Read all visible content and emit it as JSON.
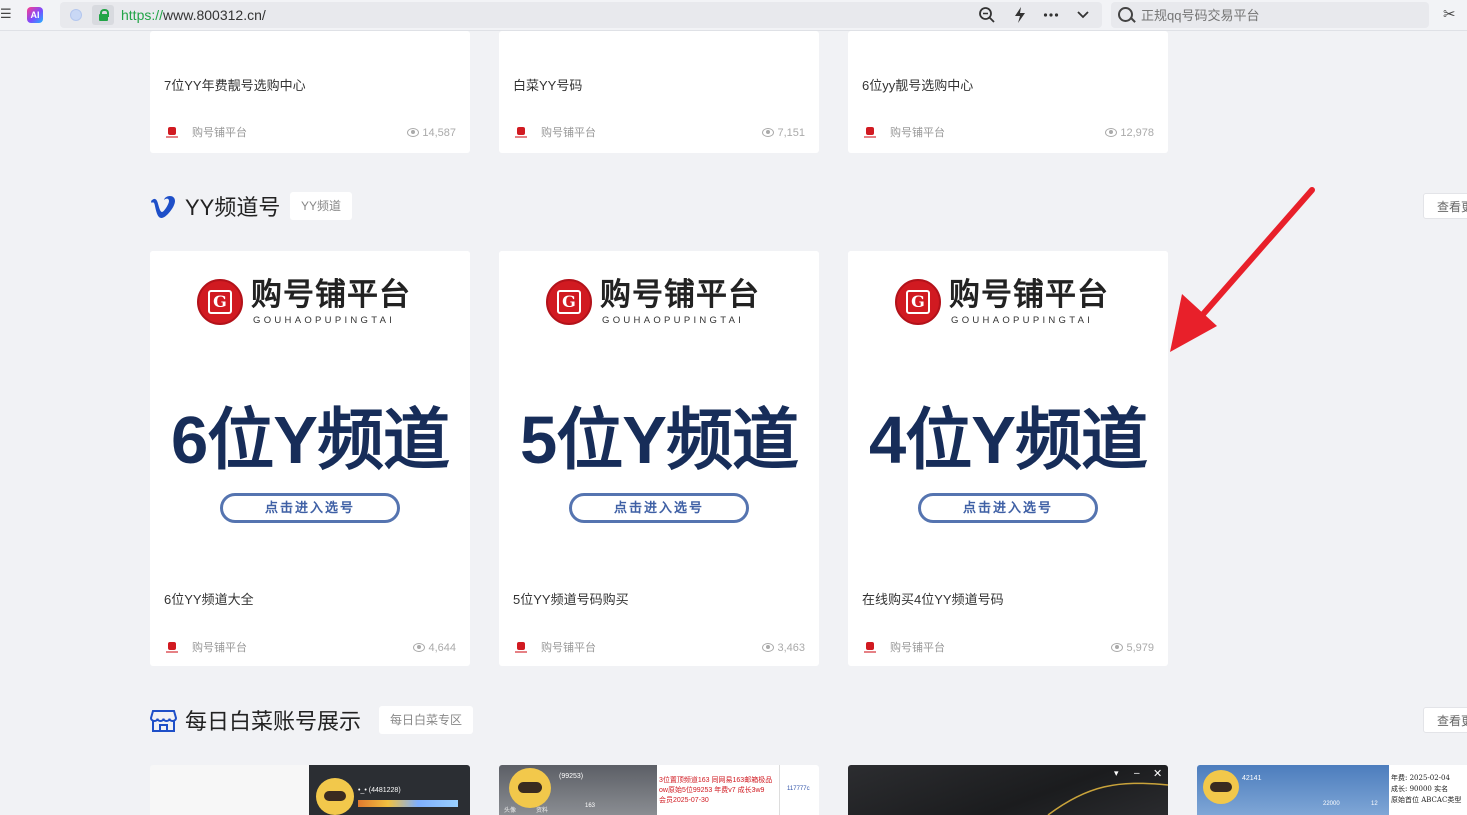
{
  "browser": {
    "left_icon": "books-icon",
    "ai_badge": "AI",
    "url_scheme": "https://",
    "url_rest": "www.800312.cn/",
    "search_placeholder": "正规qq号码交易平台",
    "scissors": "✂"
  },
  "top_cards": [
    {
      "title": "7位YY年费靓号选购中心",
      "author": "购号铺平台",
      "views": "14,587"
    },
    {
      "title": "白菜YY号码",
      "author": "购号铺平台",
      "views": "7,151"
    },
    {
      "title": "6位yy靓号选购中心",
      "author": "购号铺平台",
      "views": "12,978"
    }
  ],
  "section_yy": {
    "title": "YY频道号",
    "tag": "YY频道",
    "more": "查看更多"
  },
  "brand": {
    "emblem_letter": "G",
    "name": "购号铺平台",
    "sub": "GOUHAOPUPINGTAI",
    "button": "点击进入选号"
  },
  "yy_cards": [
    {
      "poster_text": "6位Y频道",
      "title": "6位YY频道大全",
      "author": "购号铺平台",
      "views": "4,644"
    },
    {
      "poster_text": "5位Y频道",
      "title": "5位YY频道号码购买",
      "author": "购号铺平台",
      "views": "3,463"
    },
    {
      "poster_text": "4位Y频道",
      "title": "在线购买4位YY频道号码",
      "author": "购号铺平台",
      "views": "5,979"
    }
  ],
  "section_daily": {
    "title": "每日白菜账号展示",
    "tag": "每日白菜专区",
    "more": "查看更多"
  },
  "daily_thumbs": [
    {
      "caption": "•_• (4481228)"
    },
    {
      "caption": "(99253)",
      "detail_1": "3位置顶频道163  同网易163邮箱极品",
      "detail_2": "ow原始5位99253 年费v7 成长3w9",
      "detail_3": "会员2025-07-30",
      "right": "117777c",
      "count": "163",
      "tab_a": "头像",
      "tab_b": "资料"
    },
    {
      "caption": ""
    },
    {
      "caption": "42141",
      "note_1": "年费: 2025-02-04",
      "note_2": "成长: 90000  实名",
      "note_3": "原始首位 ABCAC类型",
      "stat_a": "22000",
      "stat_b": "12"
    }
  ],
  "colors": {
    "accent_green": "#22a447",
    "brand_red": "#d11a21",
    "poster_navy": "#172d59",
    "arrow_red": "#e8202a"
  }
}
